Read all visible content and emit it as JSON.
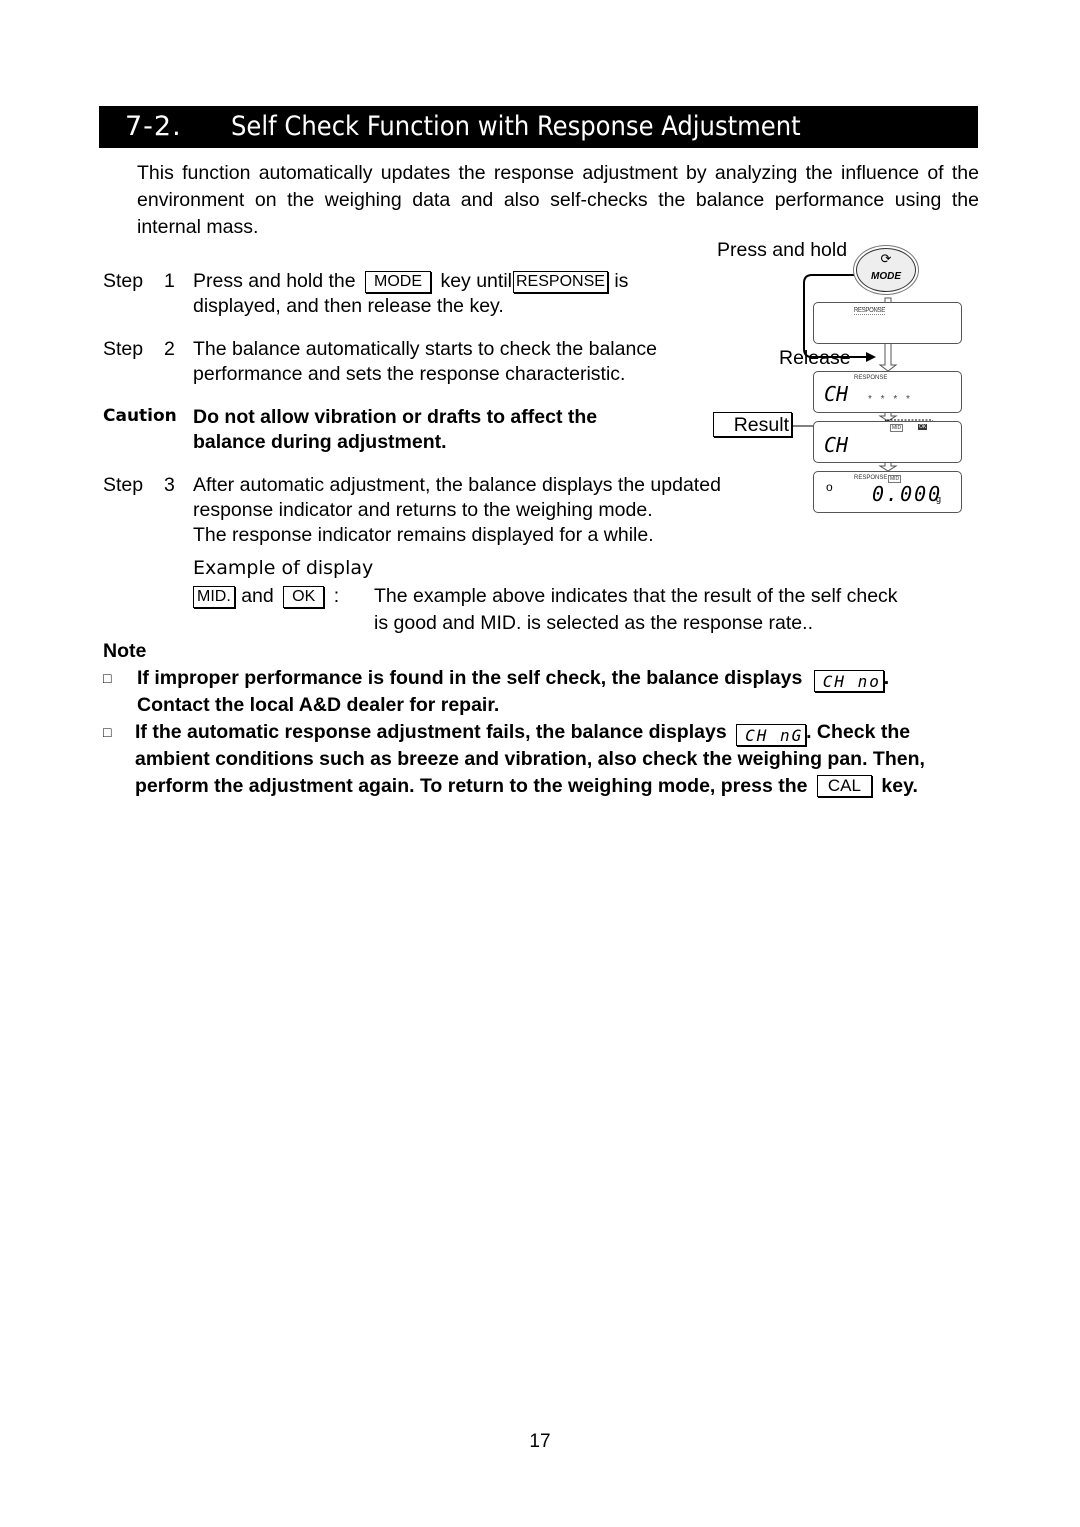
{
  "header": {
    "section_number": "7-2.",
    "section_title": "Self Check Function with Response Adjustment"
  },
  "intro": "This function automatically updates the response adjustment by analyzing the influence of the environment on the weighing data and also self-checks the balance performance using the internal mass.",
  "steps": [
    {
      "label": "Step",
      "number": "1",
      "text_before": "Press and hold the",
      "key": "MODE",
      "text_middle": "key until",
      "indicator": "RESPONSE",
      "text_after": "is",
      "line2": "displayed, and then release the key."
    },
    {
      "label": "Step",
      "number": "2",
      "line1": "The balance automatically starts to check the balance",
      "line2": "performance and sets the response characteristic."
    },
    {
      "label": "Step",
      "number": "3",
      "line1": "After automatic adjustment, the balance displays the updated",
      "line2": "response indicator and returns to the weighing mode.",
      "line3": "The response indicator remains displayed for a while."
    }
  ],
  "caution": {
    "label": "Caution",
    "line1": "Do not allow vibration or drafts to affect the",
    "line2": "balance during adjustment."
  },
  "example": {
    "heading": "Example of display",
    "key1": "MID.",
    "and": "and",
    "key2": "OK",
    "colon": ":",
    "line1": "The example above indicates that the result of the self check",
    "line2": "is good and MID. is selected as the response rate.."
  },
  "note": {
    "heading": "Note",
    "bullet_icon": "□",
    "items": [
      {
        "text_before": "If improper performance is found in the self check, the balance displays",
        "display": "CH no",
        "text_after": ".",
        "line2": "Contact the local A&D dealer for repair."
      },
      {
        "text_before": "If the automatic response adjustment fails, the balance displays",
        "display": "CH nG",
        "text_after": ". Check the",
        "line2": "ambient conditions such as breeze and vibration, also check the weighing pan. Then,",
        "line3_before": "perform the adjustment again. To return to the weighing mode, press the",
        "key": "CAL",
        "line3_after": "key."
      }
    ]
  },
  "diagram": {
    "press_and_hold": "Press and hold",
    "mode_button": "MODE",
    "release": "Release",
    "result": "Result",
    "response_tag": "RESPONSE",
    "mid_tag": "MID",
    "ok_tag": "OK",
    "display_ch": "CH",
    "display_stars": "* * * *",
    "display_weight": "0.000",
    "unit": "g",
    "zero_mark": "o"
  },
  "page_number": "17"
}
